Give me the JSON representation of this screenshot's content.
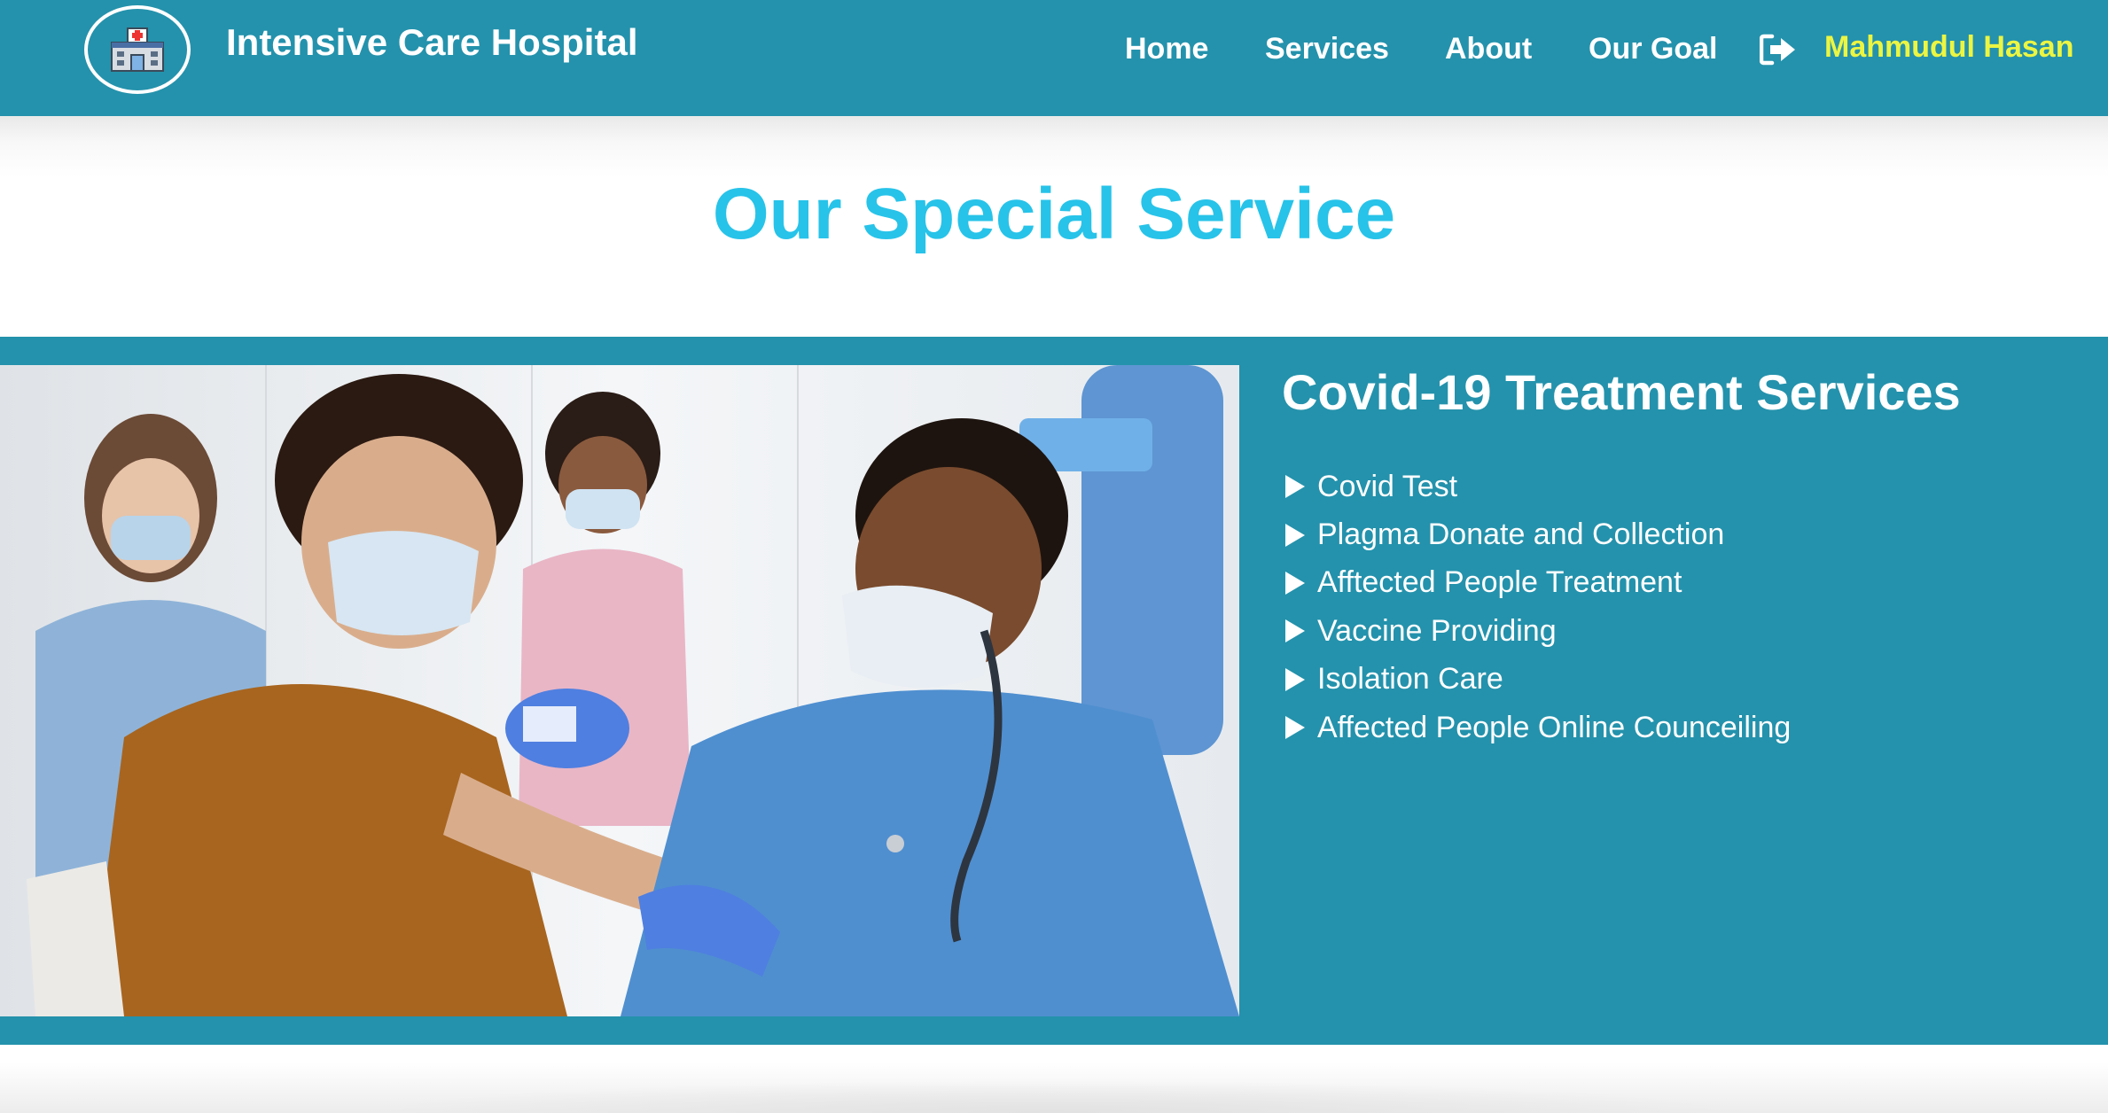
{
  "navbar": {
    "brand": "Intensive Care Hospital",
    "logo_icon": "hospital-icon",
    "links": [
      {
        "label": "Home"
      },
      {
        "label": "Services"
      },
      {
        "label": "About"
      },
      {
        "label": "Our Goal"
      }
    ],
    "logout_icon": "sign-out-icon",
    "user_name": "Mahmudul Hasan"
  },
  "section_title": "Our Special Service",
  "service": {
    "heading": "Covid-19 Treatment Services",
    "items": [
      "Covid Test",
      "Plagma Donate and Collection",
      "Afftected People Treatment",
      "Vaccine Providing",
      "Isolation Care",
      "Affected People Online Counceiling"
    ],
    "photo_subject": "nurse-vaccinating-patient-photo"
  },
  "colors": {
    "nav_bg": "#2492ac",
    "band_bg": "#2492ac",
    "title_color": "#27c3e9",
    "user_name_color": "#ecf542",
    "text_white": "#ffffff"
  }
}
